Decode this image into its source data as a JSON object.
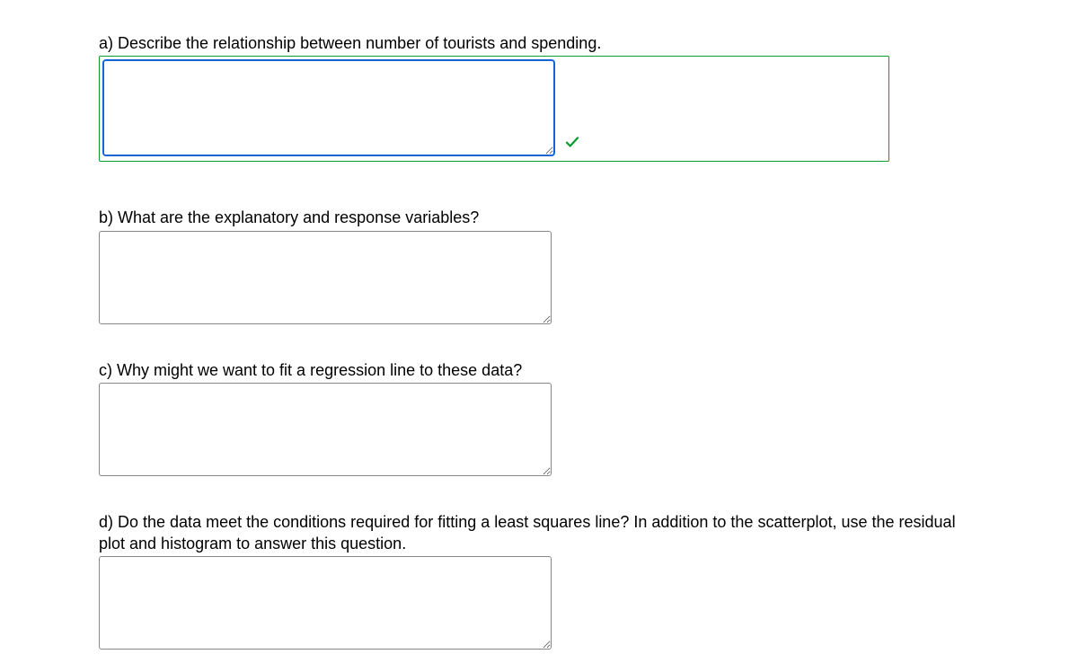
{
  "questions": {
    "a": {
      "label": "a) Describe the relationship between number of tourists and spending.",
      "value": "",
      "correct": true
    },
    "b": {
      "label": "b) What are the explanatory and response variables?",
      "value": ""
    },
    "c": {
      "label": "c) Why might we want to fit a regression line to these data?",
      "value": ""
    },
    "d": {
      "label": "d) Do the data meet the conditions required for fitting a least squares line? In addition to the scatterplot, use the residual plot and histogram to answer this question.",
      "value": ""
    }
  }
}
